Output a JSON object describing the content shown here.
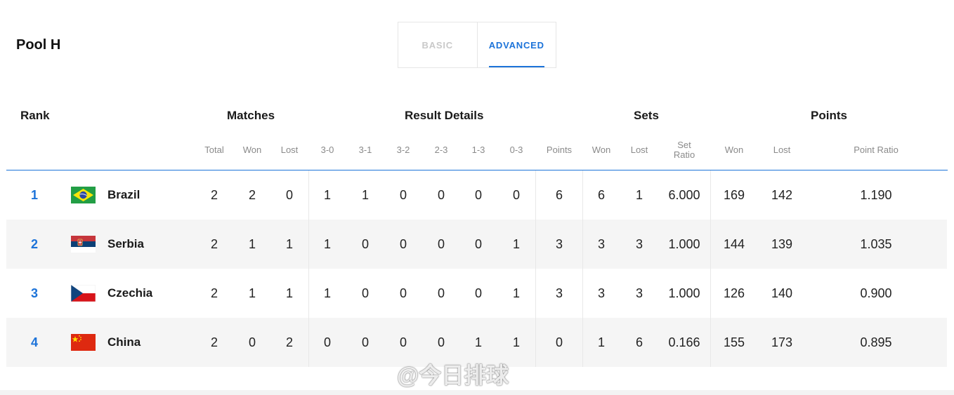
{
  "header": {
    "title": "Pool H"
  },
  "tabs": [
    {
      "label": "BASIC",
      "active": false
    },
    {
      "label": "ADVANCED",
      "active": true
    }
  ],
  "groups": {
    "rank": "Rank",
    "matches": "Matches",
    "result_details": "Result Details",
    "sets": "Sets",
    "points": "Points"
  },
  "subheaders": {
    "total": "Total",
    "won": "Won",
    "lost": "Lost",
    "r30": "3-0",
    "r31": "3-1",
    "r32": "3-2",
    "r23": "2-3",
    "r13": "1-3",
    "r03": "0-3",
    "points": "Points",
    "sets_won": "Won",
    "sets_lost": "Lost",
    "set_ratio_1": "Set",
    "set_ratio_2": "Ratio",
    "pts_won": "Won",
    "pts_lost": "Lost",
    "point_ratio": "Point Ratio"
  },
  "rows": [
    {
      "rank": "1",
      "team": "Brazil",
      "flag": "brazil-flag",
      "total": "2",
      "won": "2",
      "lost": "0",
      "r30": "1",
      "r31": "1",
      "r32": "0",
      "r23": "0",
      "r13": "0",
      "r03": "0",
      "points": "6",
      "sets_won": "6",
      "sets_lost": "1",
      "set_ratio": "6.000",
      "pts_won": "169",
      "pts_lost": "142",
      "point_ratio": "1.190"
    },
    {
      "rank": "2",
      "team": "Serbia",
      "flag": "serbia-flag",
      "total": "2",
      "won": "1",
      "lost": "1",
      "r30": "1",
      "r31": "0",
      "r32": "0",
      "r23": "0",
      "r13": "0",
      "r03": "1",
      "points": "3",
      "sets_won": "3",
      "sets_lost": "3",
      "set_ratio": "1.000",
      "pts_won": "144",
      "pts_lost": "139",
      "point_ratio": "1.035"
    },
    {
      "rank": "3",
      "team": "Czechia",
      "flag": "czechia-flag",
      "total": "2",
      "won": "1",
      "lost": "1",
      "r30": "1",
      "r31": "0",
      "r32": "0",
      "r23": "0",
      "r13": "0",
      "r03": "1",
      "points": "3",
      "sets_won": "3",
      "sets_lost": "3",
      "set_ratio": "1.000",
      "pts_won": "126",
      "pts_lost": "140",
      "point_ratio": "0.900"
    },
    {
      "rank": "4",
      "team": "China",
      "flag": "china-flag",
      "total": "2",
      "won": "0",
      "lost": "2",
      "r30": "0",
      "r31": "0",
      "r32": "0",
      "r23": "0",
      "r13": "1",
      "r03": "1",
      "points": "0",
      "sets_won": "1",
      "sets_lost": "6",
      "set_ratio": "0.166",
      "pts_won": "155",
      "pts_lost": "173",
      "point_ratio": "0.895"
    }
  ],
  "watermark": "@今日排球",
  "colors": {
    "accent": "#1c73d9",
    "row_alt": "#f5f5f5"
  }
}
